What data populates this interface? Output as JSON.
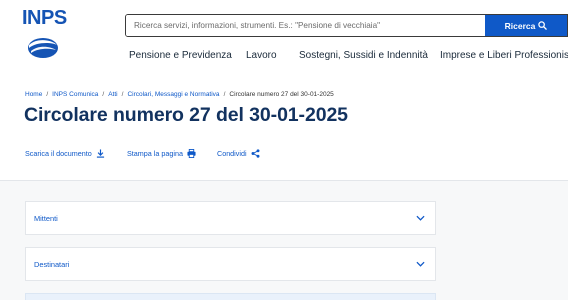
{
  "brand": {
    "logo_text": "INPS",
    "color": "#1554b4"
  },
  "search": {
    "placeholder": "Ricerca servizi, informazioni, strumenti. Es.: \"Pensione di vecchiaia\"",
    "button_label": "Ricerca",
    "button_icon": "search-icon",
    "button_color": "#0f59c8"
  },
  "nav": {
    "items": [
      {
        "label": "Pensione e Previdenza"
      },
      {
        "label": "Lavoro"
      },
      {
        "label": "Sostegni, Sussidi e Indennità"
      },
      {
        "label": "Imprese e Liberi Professionisti"
      }
    ]
  },
  "breadcrumb": {
    "items": [
      {
        "label": "Home"
      },
      {
        "label": "INPS Comunica"
      },
      {
        "label": "Atti"
      },
      {
        "label": "Circolari, Messaggi e Normativa"
      }
    ],
    "separator": "/",
    "current": "Circolare numero 27 del 30-01-2025"
  },
  "page": {
    "title": "Circolare numero 27 del 30-01-2025",
    "title_color": "#12325f"
  },
  "actions": {
    "download": {
      "label": "Scarica il documento",
      "icon": "download-icon"
    },
    "print": {
      "label": "Stampa la pagina",
      "icon": "printer-icon"
    },
    "share": {
      "label": "Condividi",
      "icon": "share-icon"
    }
  },
  "accordion": {
    "items": [
      {
        "label": "Mittenti",
        "icon": "chevron-down-icon"
      },
      {
        "label": "Destinatari",
        "icon": "chevron-down-icon"
      }
    ]
  }
}
